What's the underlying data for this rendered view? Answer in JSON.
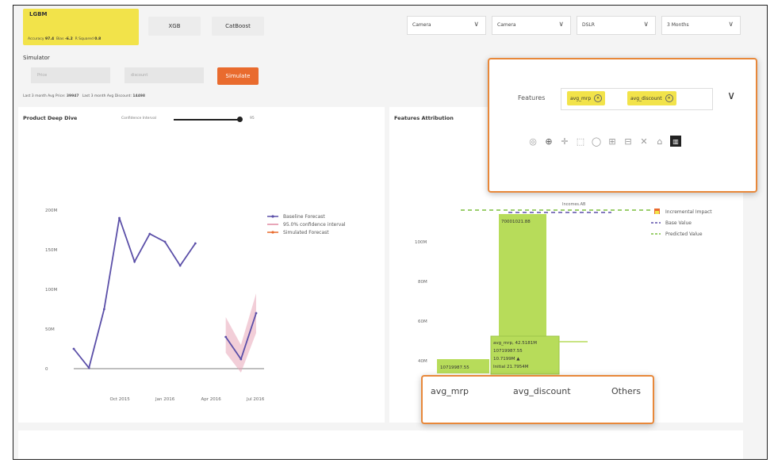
{
  "models": {
    "active": {
      "name": "LGBM",
      "metrics": [
        {
          "label": "Accuracy",
          "value": "97.4"
        },
        {
          "label": "Bias",
          "value": "-6.2"
        },
        {
          "label": "R Squared",
          "value": "0.8"
        }
      ]
    },
    "others": [
      "XGB",
      "CatBoost"
    ]
  },
  "filters": [
    "Camera",
    "Camera",
    "DSLR",
    "3 Months"
  ],
  "simulator": {
    "title": "Simulator",
    "price_placeholder": "Price",
    "discount_placeholder": "discount",
    "button": "Simulate",
    "last_price_label": "Last 3 month Avg Price:",
    "last_price_value": "39947",
    "last_discount_label": "Last 3 month Avg Discount:",
    "last_discount_value": "14498"
  },
  "deep_dive": {
    "title": "Product Deep Dive",
    "slider_label": "Confidence Interval",
    "slider_value": "95",
    "y_ticks": [
      "200M",
      "150M",
      "100M",
      "50M",
      "0"
    ],
    "x_ticks": [
      "Oct 2015",
      "Jan 2016",
      "Apr 2016",
      "Jul 2016"
    ],
    "legend": [
      "Baseline Forecast",
      "95.0% confidence interval",
      "Simulated Forecast"
    ],
    "colors": {
      "baseline": "#5b4fa8",
      "interval": "#e8a6b8",
      "simulated": "#e96b2e"
    }
  },
  "chart_data": {
    "type": "line",
    "x": [
      "2015-07",
      "2015-08",
      "2015-09",
      "2015-10",
      "2015-11",
      "2015-12",
      "2016-01",
      "2016-02",
      "2016-03",
      "2016-04",
      "2016-05",
      "2016-06",
      "2016-07"
    ],
    "series": [
      {
        "name": "Baseline Forecast",
        "values": [
          25,
          1,
          75,
          190,
          135,
          170,
          160,
          130,
          158,
          null,
          null,
          null,
          null
        ]
      },
      {
        "name": "Simulated Forecast",
        "values": [
          null,
          null,
          null,
          null,
          null,
          null,
          null,
          null,
          null,
          null,
          40,
          12,
          70
        ]
      },
      {
        "name": "95.0% confidence interval",
        "lower": [
          null,
          null,
          null,
          null,
          null,
          null,
          null,
          null,
          null,
          null,
          20,
          -5,
          45
        ],
        "upper": [
          null,
          null,
          null,
          null,
          null,
          null,
          null,
          null,
          null,
          null,
          65,
          30,
          95
        ]
      }
    ],
    "ylim": [
      0,
      200
    ],
    "y_unit": "M"
  },
  "attribution": {
    "title": "Features Attribution",
    "y_ticks": [
      "100M",
      "80M",
      "60M",
      "40M"
    ],
    "top_label": "Incomes.AB",
    "bar_labels": [
      "10719987.55",
      "70001021.88"
    ],
    "tooltip": [
      "avg_mrp, 42.5181M",
      "10719987.55",
      "10.7199M ▲",
      "Initial 21.7954M"
    ],
    "legend": [
      "Incremental Impact",
      "Base Value",
      "Predicted Value"
    ],
    "colors": {
      "bar": "#b7dc5a",
      "base": "#5b4fa8",
      "predicted": "#7bbf3e"
    }
  },
  "features_overlay": {
    "label": "Features",
    "chips": [
      "avg_mrp",
      "avg_discount"
    ],
    "toolbar_icons": [
      "camera-icon",
      "zoom-icon",
      "pan-icon",
      "box-select-icon",
      "lasso-icon",
      "zoom-in-icon",
      "zoom-out-icon",
      "autoscale-icon",
      "home-icon",
      "bar-chart-icon"
    ]
  },
  "xaxis_overlay": [
    "avg_mrp",
    "avg_discount",
    "Others"
  ]
}
